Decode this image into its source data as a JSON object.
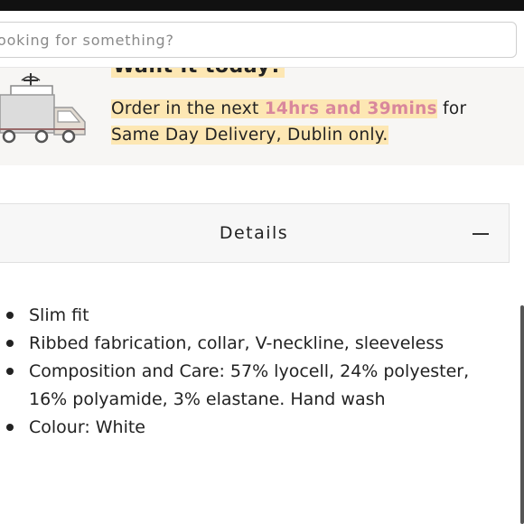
{
  "search": {
    "placeholder": "ooking for something?"
  },
  "delivery": {
    "heading": "Want it today?",
    "order_prefix": "Order in the next ",
    "countdown": "14hrs and 39mins",
    "order_suffix": " for",
    "order_line2": "Same Day Delivery, Dublin only.",
    "icon": "delivery-truck-icon"
  },
  "details": {
    "title": "Details",
    "toggle_icon": "minus-icon",
    "items": [
      "Slim fit",
      "Ribbed fabrication, collar, V-neckline, sleeveless",
      "Composition and Care: 57% lyocell, 24% polyester, 16% polyamide, 3% elastane. Hand wash",
      "Colour: White"
    ]
  },
  "colors": {
    "highlight": "#fde7b3",
    "countdown": "#d9879c",
    "panel_bg": "#f7f6f4"
  }
}
